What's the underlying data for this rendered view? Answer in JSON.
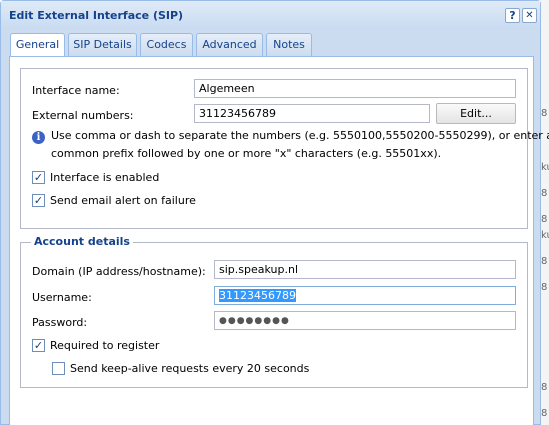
{
  "window": {
    "title": "Edit External Interface (SIP)",
    "help_label": "?",
    "close_label": "✕"
  },
  "tabs": [
    "General",
    "SIP Details",
    "Codecs",
    "Advanced",
    "Notes"
  ],
  "active_tab": "General",
  "general": {
    "interface_name_label": "Interface name:",
    "interface_name_value": "Algemeen",
    "external_numbers_label": "External numbers:",
    "external_numbers_value": "31123456789",
    "edit_button": "Edit...",
    "info_line1": "Use comma or dash to separate the numbers (e.g. 5550100,5550200-5550299), or enter a",
    "info_line2": "common prefix followed by one or more \"x\" characters (e.g. 55501xx).",
    "interface_enabled_label": "Interface is enabled",
    "interface_enabled_checked": true,
    "email_alert_label": "Send email alert on failure",
    "email_alert_checked": true
  },
  "account": {
    "legend": "Account details",
    "domain_label": "Domain (IP address/hostname):",
    "domain_value": "sip.speakup.nl",
    "username_label": "Username:",
    "username_value": "31123456789",
    "password_label": "Password:",
    "password_value": "●●●●●●●●",
    "register_label": "Required to register",
    "register_checked": true,
    "keepalive_label": "Send keep-alive requests every 20 seconds",
    "keepalive_checked": false
  },
  "background_edge_chars": [
    "8",
    "ku",
    "8",
    "8",
    "ku",
    "8",
    "8",
    "8",
    "8"
  ],
  "colors": {
    "title_text": "#15428b",
    "window_border": "#99bbe8",
    "selection": "#3399ff"
  }
}
